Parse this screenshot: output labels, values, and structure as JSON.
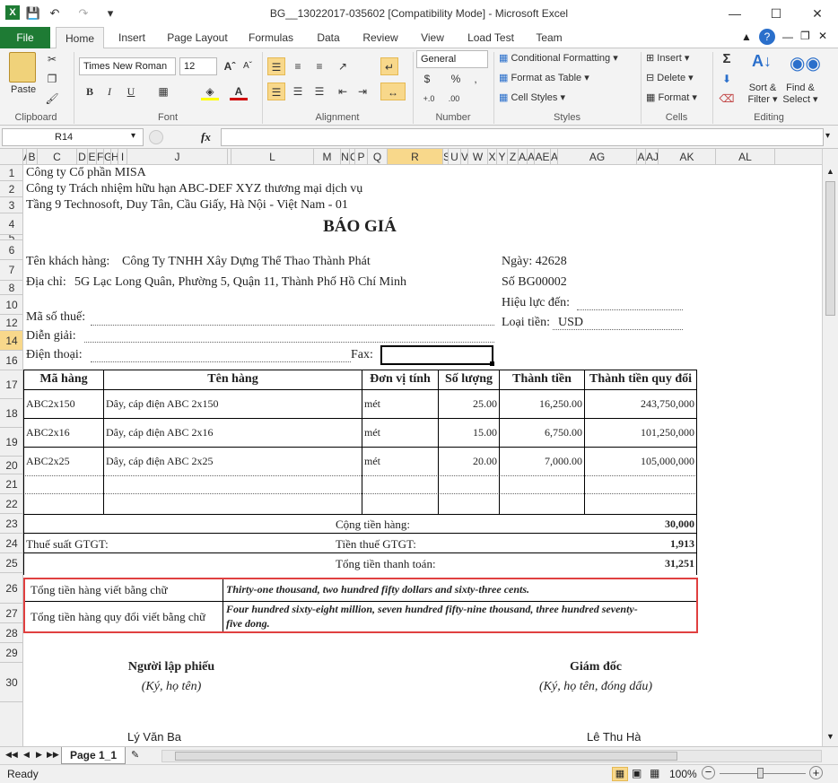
{
  "window": {
    "title": "BG__13022017-035602  [Compatibility Mode]  -  Microsoft Excel",
    "minimize": "—",
    "maximize": "☐",
    "close": "✕"
  },
  "tabs": [
    "File",
    "Home",
    "Insert",
    "Page Layout",
    "Formulas",
    "Data",
    "Review",
    "View",
    "Load Test",
    "Team"
  ],
  "ribbon": {
    "clipboard": {
      "paste": "Paste",
      "label": "Clipboard"
    },
    "font": {
      "name": "Times New Roman",
      "size": "12",
      "bold": "B",
      "italic": "I",
      "underline": "U",
      "label": "Font"
    },
    "alignment": {
      "label": "Alignment"
    },
    "number": {
      "format": "General",
      "currency": "$",
      "percent": "%",
      "comma": ",",
      "inc": "+.0",
      "dec": ".00",
      "label": "Number"
    },
    "styles": {
      "conditional": "Conditional Formatting",
      "table": "Format as Table",
      "cell": "Cell Styles",
      "label": "Styles"
    },
    "cells": {
      "insert": "Insert",
      "delete": "Delete",
      "format": "Format",
      "label": "Cells"
    },
    "editing": {
      "sigma": "Σ",
      "sort": "Sort &",
      "filter": "Filter",
      "find": "Find &",
      "select": "Select",
      "label": "Editing"
    }
  },
  "formula_bar": {
    "name_box": "R14",
    "fx": "fx",
    "value": ""
  },
  "columns": [
    {
      "label": "A",
      "w": 4
    },
    {
      "label": "B",
      "w": 12
    },
    {
      "label": "C",
      "w": 44
    },
    {
      "label": "D",
      "w": 12
    },
    {
      "label": "E",
      "w": 10
    },
    {
      "label": "F",
      "w": 8
    },
    {
      "label": "G",
      "w": 8
    },
    {
      "label": "H",
      "w": 8
    },
    {
      "label": "I",
      "w": 10
    },
    {
      "label": "J",
      "w": 112
    },
    {
      "label": "",
      "w": 4
    },
    {
      "label": "L",
      "w": 92
    },
    {
      "label": "M",
      "w": 30
    },
    {
      "label": "N",
      "w": 10
    },
    {
      "label": "O",
      "w": 6
    },
    {
      "label": "P",
      "w": 14
    },
    {
      "label": "Q",
      "w": 22
    },
    {
      "label": "R",
      "w": 62
    },
    {
      "label": "S",
      "w": 6
    },
    {
      "label": "U",
      "w": 14
    },
    {
      "label": "V",
      "w": 8
    },
    {
      "label": "W",
      "w": 22
    },
    {
      "label": "X",
      "w": 10
    },
    {
      "label": "Y",
      "w": 12
    },
    {
      "label": "Z",
      "w": 12
    },
    {
      "label": "AA",
      "w": 10
    },
    {
      "label": "A",
      "w": 8
    },
    {
      "label": "AE",
      "w": 18
    },
    {
      "label": "A",
      "w": 8
    },
    {
      "label": "AG",
      "w": 88
    },
    {
      "label": "A",
      "w": 10
    },
    {
      "label": "AJ",
      "w": 14
    },
    {
      "label": "AK",
      "w": 64
    },
    {
      "label": "AL",
      "w": 66
    }
  ],
  "rows": [
    "1",
    "2",
    "3",
    "4",
    "5",
    "6",
    "7",
    "8",
    "10",
    "12",
    "14",
    "16",
    "17",
    "18",
    "19",
    "20",
    "21",
    "22",
    "23",
    "24",
    "25",
    "26",
    "27",
    "28",
    "29",
    "30"
  ],
  "company": {
    "line1": "Công ty Cổ phần MISA",
    "line2": "Công ty Trách nhiệm hữu hạn ABC-DEF XYZ thương mại dịch vụ",
    "line3": "Tầng 9 Technosoft, Duy Tân, Cầu Giấy, Hà Nội - Việt Nam - 01"
  },
  "doc_title": "BÁO GIÁ",
  "customer": {
    "name_label": "Tên khách hàng:",
    "name": "Công Ty TNHH Xây Dựng Thể Thao Thành Phát",
    "address_label": "Địa chỉ:",
    "address": "5G Lạc Long Quân, Phường 5, Quận 11, Thành Phố Hồ Chí Minh",
    "tax_label": "Mã số thuế:",
    "desc_label": "Diễn giải:",
    "phone_label": "Điện thoại:",
    "fax_label": "Fax:"
  },
  "doc_info": {
    "date": "Ngày: 42628",
    "number": "Số BG00002",
    "valid": "Hiệu lực đến:",
    "currency_label": "Loại tiền:",
    "currency": "USD"
  },
  "table": {
    "headers": [
      "Mã hàng",
      "Tên hàng",
      "Đơn vị tính",
      "Số lượng",
      "Thành tiền",
      "Thành tiền quy đổi"
    ],
    "rows": [
      [
        "ABC2x150",
        "Dây, cáp điện ABC 2x150",
        "mét",
        "25.00",
        "16,250.00",
        "243,750,000"
      ],
      [
        "ABC2x16",
        "Dây, cáp điện ABC 2x16",
        "mét",
        "15.00",
        "6,750.00",
        "101,250,000"
      ],
      [
        "ABC2x25",
        "Dây, cáp điện ABC 2x25",
        "mét",
        "20.00",
        "7,000.00",
        "105,000,000"
      ]
    ]
  },
  "totals": {
    "subtotal_label": "Cộng tiền hàng:",
    "subtotal": "30,000",
    "tax_rate_label": "Thuế suất GTGT:",
    "tax_label": "Tiền thuế GTGT:",
    "tax": "1,913",
    "total_label": "Tổng tiền thanh toán:",
    "total": "31,251",
    "words_label": "Tổng tiền hàng viết bằng chữ",
    "words": "Thirty-one thousand, two hundred fifty dollars and sixty-three cents.",
    "words_conv_label": "Tổng tiền hàng quy đổi viết bằng chữ",
    "words_conv_1": "Four hundred sixty-eight million, seven hundred fifty-nine thousand, three hundred seventy-",
    "words_conv_2": "five dong."
  },
  "signatures": {
    "creator_title": "Người lập phiếu",
    "creator_note": "(Ký, họ tên)",
    "creator_name": "Lý Văn Ba",
    "director_title": "Giám đốc",
    "director_note": "(Ký, họ tên, đóng dấu)",
    "director_name": "Lê Thu Hà"
  },
  "sheet_tab": "Page 1_1",
  "status": {
    "ready": "Ready",
    "zoom": "100%"
  }
}
